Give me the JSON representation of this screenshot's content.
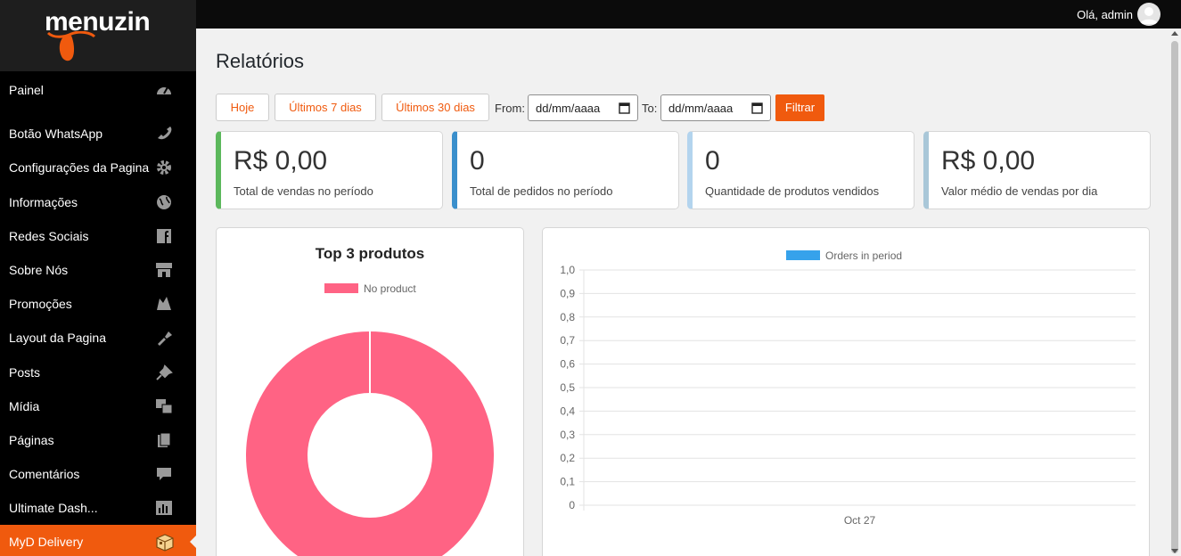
{
  "topbar": {
    "greeting": "Olá, admin",
    "avatar_icon": "user-avatar-icon"
  },
  "logo": {
    "text": "menuzin"
  },
  "sidebar": {
    "items": [
      {
        "label": "Painel",
        "icon": "dashboard-icon"
      },
      {
        "label": "Botão WhatsApp",
        "icon": "phone-icon"
      },
      {
        "label": "Configurações da Pagina",
        "icon": "gear-icon"
      },
      {
        "label": "Informações",
        "icon": "globe-icon"
      },
      {
        "label": "Redes Sociais",
        "icon": "facebook-icon"
      },
      {
        "label": "Sobre Nós",
        "icon": "store-icon"
      },
      {
        "label": "Promoções",
        "icon": "promotions-icon"
      },
      {
        "label": "Layout da Pagina",
        "icon": "brush-icon"
      },
      {
        "label": "Posts",
        "icon": "pin-icon"
      },
      {
        "label": "Mídia",
        "icon": "media-icon"
      },
      {
        "label": "Páginas",
        "icon": "pages-icon"
      },
      {
        "label": "Comentários",
        "icon": "comment-icon"
      },
      {
        "label": "Ultimate Dash...",
        "icon": "chart-icon"
      },
      {
        "label": "MyD Delivery",
        "icon": "box-icon",
        "active": true
      }
    ]
  },
  "page": {
    "title": "Relatórios"
  },
  "filters": {
    "today": "Hoje",
    "last7": "Últimos 7 dias",
    "last30": "Últimos 30 dias",
    "from_label": "From:",
    "from_value": "dd/mm/aaaa",
    "to_label": "To:",
    "to_value": "dd/mm/aaaa",
    "filter_button": "Filtrar"
  },
  "stats": [
    {
      "value": "R$ 0,00",
      "caption": "Total de vendas no período",
      "color": "#5cb85c"
    },
    {
      "value": "0",
      "caption": "Total de pedidos no período",
      "color": "#3a8fcc"
    },
    {
      "value": "0",
      "caption": "Quantidade de produtos vendidos",
      "color": "#b3d4ee"
    },
    {
      "value": "R$ 0,00",
      "caption": "Valor médio de vendas por dia",
      "color": "#a9c7d8"
    }
  ],
  "colors": {
    "accent": "#f05a0e",
    "pie": "#ff6384",
    "bar": "#36a2eb"
  },
  "chart_data": [
    {
      "type": "pie",
      "title": "Top 3 produtos",
      "categories": [
        "No product"
      ],
      "values": [
        1
      ],
      "legend": "top"
    },
    {
      "type": "bar",
      "title": "",
      "categories": [
        "Oct 27"
      ],
      "series": [
        {
          "name": "Orders in period",
          "values": [
            0
          ]
        }
      ],
      "yticks": [
        "1,0",
        "0,9",
        "0,8",
        "0,7",
        "0,6",
        "0,5",
        "0,4",
        "0,3",
        "0,2",
        "0,1",
        "0"
      ],
      "ylim": [
        0,
        1
      ],
      "grid": true,
      "legend": "top"
    }
  ]
}
